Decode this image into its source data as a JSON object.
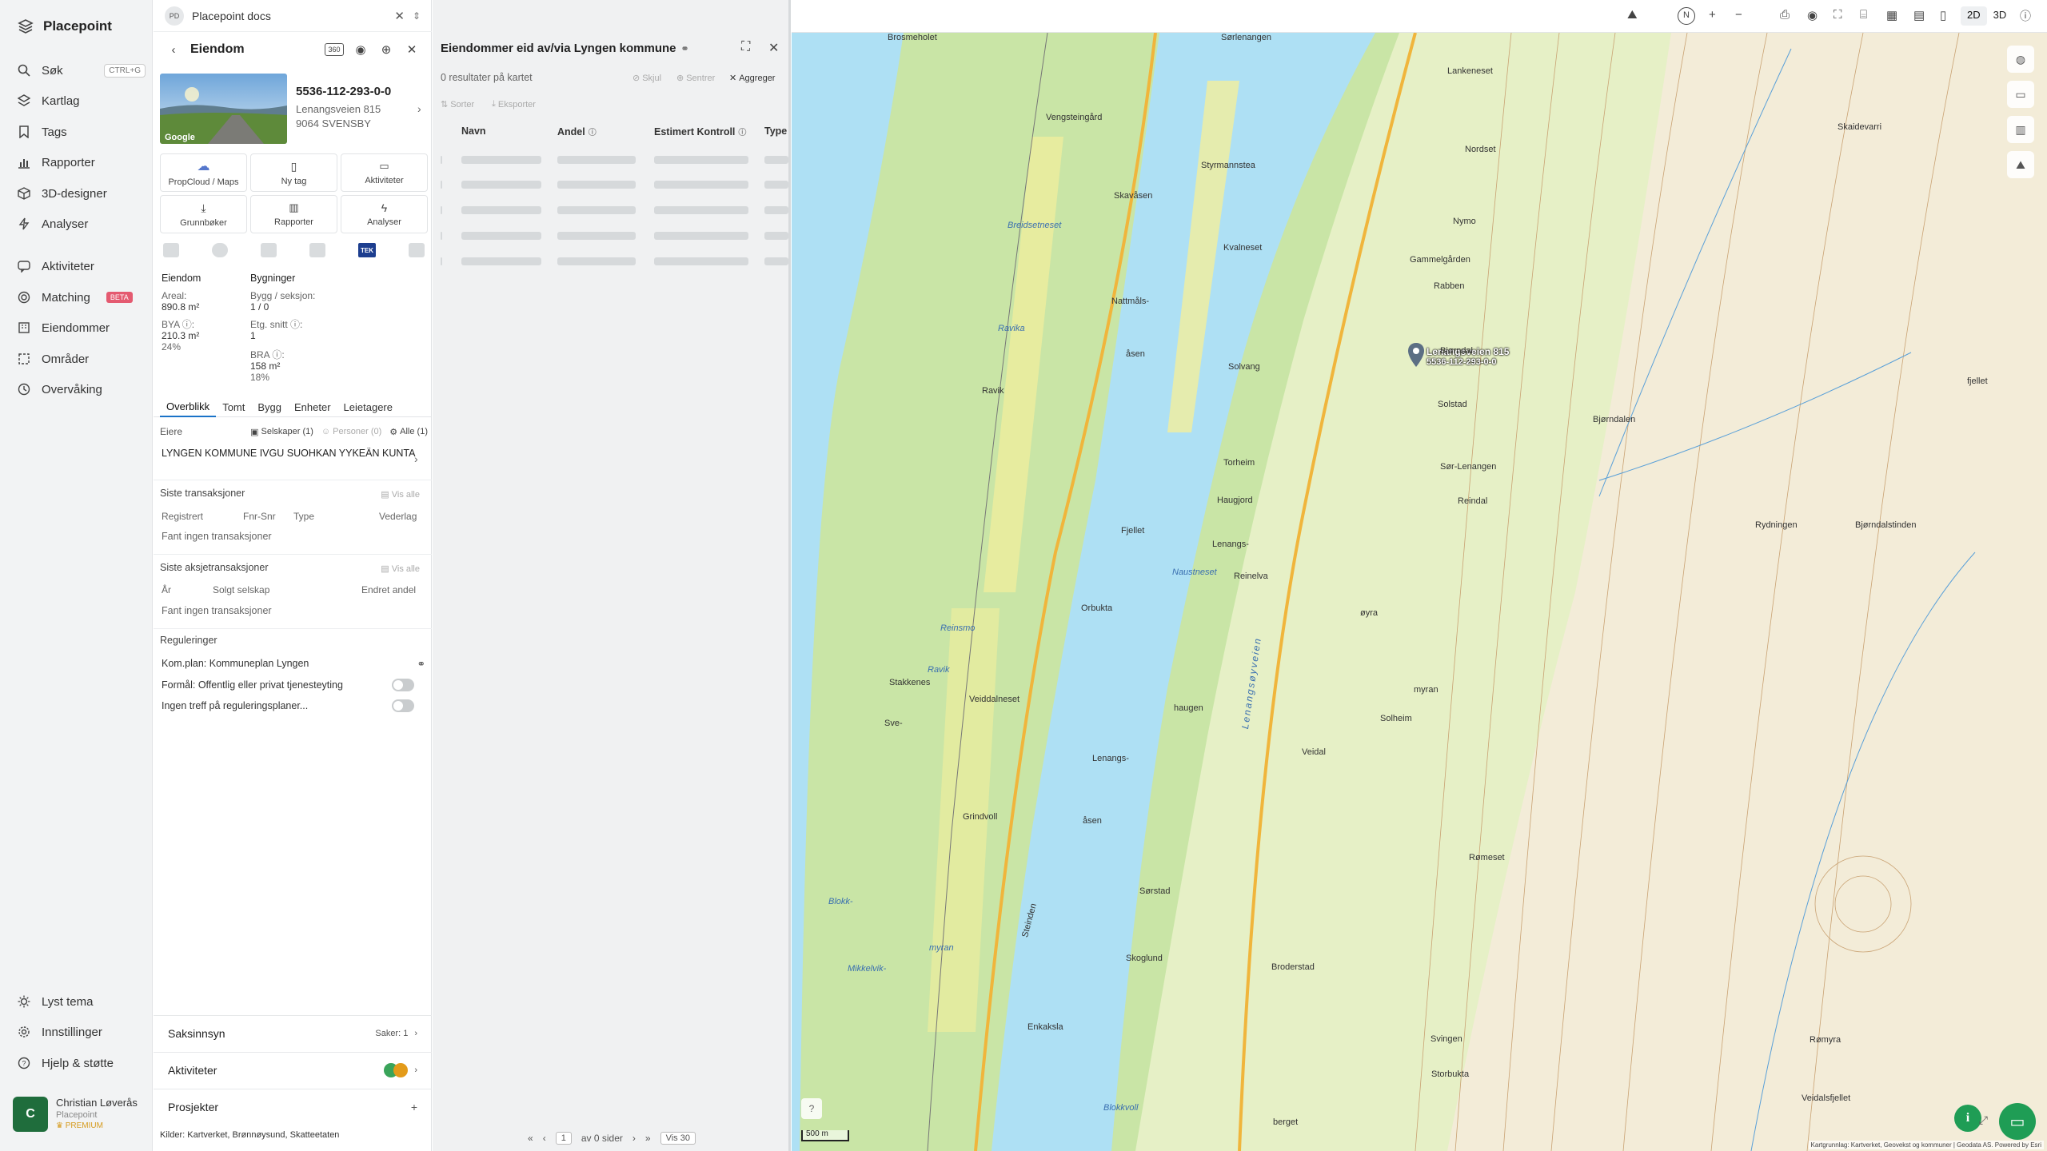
{
  "app": {
    "name": "Placepoint"
  },
  "nav": {
    "items": [
      {
        "label": "Søk",
        "shortcut": "CTRL+G"
      },
      {
        "label": "Kartlag"
      },
      {
        "label": "Tags"
      },
      {
        "label": "Rapporter"
      },
      {
        "label": "3D-designer"
      },
      {
        "label": "Analyser"
      },
      {
        "label": "Aktiviteter"
      },
      {
        "label": "Matching",
        "badge": "BETA"
      },
      {
        "label": "Eiendommer"
      },
      {
        "label": "Områder"
      },
      {
        "label": "Overvåking"
      }
    ],
    "bottom": [
      {
        "label": "Lyst tema"
      },
      {
        "label": "Innstillinger"
      },
      {
        "label": "Hjelp & støtte"
      }
    ],
    "user": {
      "initial": "C",
      "name": "Christian Løverås",
      "org": "Placepoint",
      "plan": "PREMIUM"
    }
  },
  "docbar": {
    "badge": "PD",
    "title": "Placepoint docs"
  },
  "property": {
    "header": "Eiendom",
    "id": "5536-112-293-0-0",
    "address_line1": "Lenangsveien 815",
    "address_line2": "9064 SVENSBY",
    "photo_tag": "Google",
    "actions": [
      "PropCloud / Maps",
      "Ny tag",
      "Aktiviteter",
      "Grunnbøker",
      "Rapporter",
      "Analyser"
    ],
    "tek_label": "TEK",
    "eiendom_heading": "Eiendom",
    "bygninger_heading": "Bygninger",
    "areal_label": "Areal:",
    "areal_value": "890.8 m²",
    "bya_label": "BYA ⓘ:",
    "bya_value": "210.3 m²",
    "bya_pct": "24%",
    "bygg_label": "Bygg / seksjon:",
    "bygg_value": "1 / 0",
    "etg_label": "Etg. snitt ⓘ:",
    "etg_value": "1",
    "bra_label": "BRA ⓘ:",
    "bra_value": "158 m²",
    "bra_pct": "18%",
    "tabs": [
      "Overblikk",
      "Tomt",
      "Bygg",
      "Enheter",
      "Leietagere"
    ],
    "owners_label": "Eiere",
    "owner_chips": [
      "Selskaper (1)",
      "Personer (0)",
      "Alle (1)"
    ],
    "owner_name": "LYNGEN KOMMUNE IVGU SUOHKAN YYKEÄN KUNTA",
    "tx_heading": "Siste transaksjoner",
    "vis_alle": "Vis alle",
    "tx_cols": [
      "Registrert",
      "Fnr-Snr",
      "Type",
      "Vederlag"
    ],
    "tx_none": "Fant ingen transaksjoner",
    "stx_heading": "Siste aksjetransaksjoner",
    "stx_cols": [
      "År",
      "Solgt selskap",
      "Endret andel"
    ],
    "stx_none": "Fant ingen transaksjoner",
    "reg_heading": "Reguleringer",
    "reg_items": [
      "Kom.plan: Kommuneplan Lyngen",
      "Formål: Offentlig eller privat tjenesteyting",
      "Ingen treff på reguleringsplaner..."
    ],
    "saksinnsyn": "Saksinnsyn",
    "saker": "Saker: 1",
    "aktiviteter": "Aktiviteter",
    "prosjekter": "Prosjekter",
    "sources_label": "Kilder:",
    "sources": [
      "Kartverket,",
      "Brønnøysund,",
      "Skatteetaten"
    ]
  },
  "results": {
    "title": "Eiendommer eid av/via Lyngen kommune",
    "count": "0 resultater på kartet",
    "tools_top": [
      "Skjul",
      "Sentrer",
      "Aggreger"
    ],
    "tools_left": [
      "Sorter",
      "Eksporter"
    ],
    "columns": [
      "Navn",
      "Andel",
      "Estimert Kontroll",
      "Type"
    ],
    "pager": {
      "page": "1",
      "of_label": "av 0 sider",
      "per_page": "Vis 30"
    }
  },
  "map": {
    "mode_2d": "2D",
    "mode_3d": "3D",
    "north": "N",
    "scale": "500 m",
    "attribution": "Kartgrunnlag: Kartverket, Geovekst og kommuner | Geodata AS. Powered by Esri",
    "water_color": "#aee0f4",
    "land_color": "#c9e5a6",
    "marker_label": "Lenangsveien 815",
    "marker_sub": "5536-112-293-0-0",
    "place_labels": [
      "Sørlenangen",
      "Brosmeholet",
      "Lankeneset",
      "Vengsteingård",
      "Styrmannstea",
      "Nordset",
      "Skavåsen",
      "Breidsetneset",
      "Kvalneset",
      "Nymo",
      "Gammelgården",
      "Rabben",
      "Nattmåls-",
      "Ravika",
      "åsen",
      "Solvang",
      "Bjørndal",
      "Ravik",
      "Solstad",
      "Bjørndalen",
      "Torheim",
      "Sør-Lenangen",
      "Haugjord",
      "Reindal",
      "Fjellet",
      "Lenangs-",
      "Rydningen",
      "Reinelva",
      "Naustneset",
      "Orbukta",
      "øyra",
      "Reinsmo",
      "Ravik",
      "myran",
      "Stakkenes",
      "Sve-",
      "haugen",
      "Solheim",
      "Veidal",
      "Veiddalneset",
      "Lenangs-",
      "Grindvoll",
      "åsen",
      "Sørstad",
      "Skoglund",
      "Broderstad",
      "Rømeset",
      "Enkaksla",
      "Svingen",
      "Blokkvoll",
      "Storbukta",
      "berget",
      "Blokk-",
      "Mikkelvik-",
      "myran",
      "Rømyra",
      "Veidalsfjellet",
      "Skaidevarri",
      "fjellet",
      "Bjørndalstinden",
      "Steinden",
      "Lenangsøyveien",
      "Sørlenangen"
    ]
  }
}
